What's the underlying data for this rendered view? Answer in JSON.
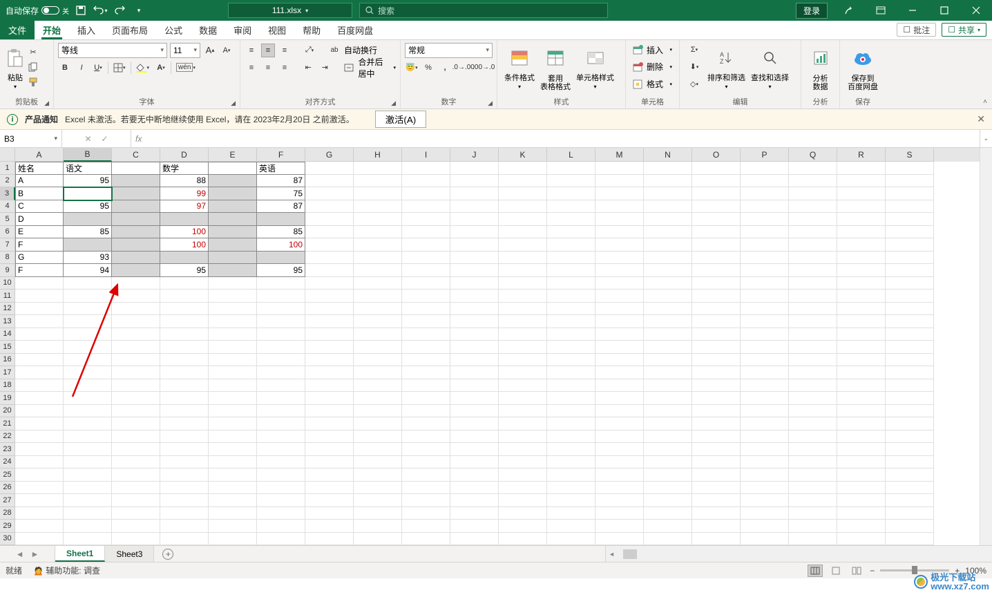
{
  "titlebar": {
    "autosave_label": "自动保存",
    "autosave_state": "关",
    "filename": "111.xlsx",
    "search_placeholder": "搜索",
    "login": "登录"
  },
  "tabs": {
    "file": "文件",
    "home": "开始",
    "insert": "插入",
    "layout": "页面布局",
    "formulas": "公式",
    "data": "数据",
    "review": "审阅",
    "view": "视图",
    "help": "帮助",
    "baidu": "百度网盘",
    "comments": "批注",
    "share": "共享"
  },
  "ribbon": {
    "clipboard": {
      "paste": "粘贴",
      "label": "剪贴板"
    },
    "font": {
      "name": "等线",
      "size": "11",
      "pinyin": "拼音",
      "label": "字体"
    },
    "align": {
      "wrap": "自动换行",
      "merge": "合并后居中",
      "label": "对齐方式"
    },
    "number": {
      "format": "常规",
      "label": "数字"
    },
    "styles": {
      "cond": "条件格式",
      "table": "套用\n表格格式",
      "cell": "单元格样式",
      "label": "样式"
    },
    "cells": {
      "insert": "插入",
      "delete": "删除",
      "format": "格式",
      "label": "单元格"
    },
    "editing": {
      "sort": "排序和筛选",
      "find": "查找和选择",
      "label": "编辑"
    },
    "analysis": {
      "btn": "分析\n数据",
      "label": "分析"
    },
    "save": {
      "btn": "保存到\n百度网盘",
      "label": "保存"
    }
  },
  "notice": {
    "title": "产品通知",
    "body": "Excel 未激活。若要无中断地继续使用 Excel，请在 2023年2月20日 之前激活。",
    "activate": "激活(A)"
  },
  "formula_bar": {
    "namebox": "B3"
  },
  "columns": [
    "A",
    "B",
    "C",
    "D",
    "E",
    "F",
    "G",
    "H",
    "I",
    "J",
    "K",
    "L",
    "M",
    "N",
    "O",
    "P",
    "Q",
    "R",
    "S"
  ],
  "col_widths": {
    "A": 70,
    "default": 70
  },
  "rows_visible": 30,
  "data_cols": 6,
  "table": {
    "headers": [
      "姓名",
      "语文",
      "",
      "数学",
      "",
      "英语"
    ],
    "rows": [
      {
        "a": "A",
        "b": "95",
        "d": "88",
        "f": "87"
      },
      {
        "a": "B",
        "b": "",
        "d": "99",
        "f": "75",
        "red": [
          "d"
        ]
      },
      {
        "a": "C",
        "b": "95",
        "d": "97",
        "f": "87",
        "red": [
          "d"
        ]
      },
      {
        "a": "D"
      },
      {
        "a": "E",
        "b": "85",
        "d": "100",
        "f": "85",
        "red": [
          "d"
        ]
      },
      {
        "a": "F",
        "b": "",
        "d": "100",
        "f": "100",
        "red": [
          "d",
          "f"
        ]
      },
      {
        "a": "G",
        "b": "93"
      },
      {
        "a": "F",
        "b": "94",
        "d": "95",
        "f": "95"
      }
    ]
  },
  "sheets": {
    "s1": "Sheet1",
    "s3": "Sheet3"
  },
  "status": {
    "ready": "就绪",
    "access": "辅助功能: 调查",
    "zoom": "100%"
  },
  "watermark": "极光下载站\nwww.xz7.com"
}
